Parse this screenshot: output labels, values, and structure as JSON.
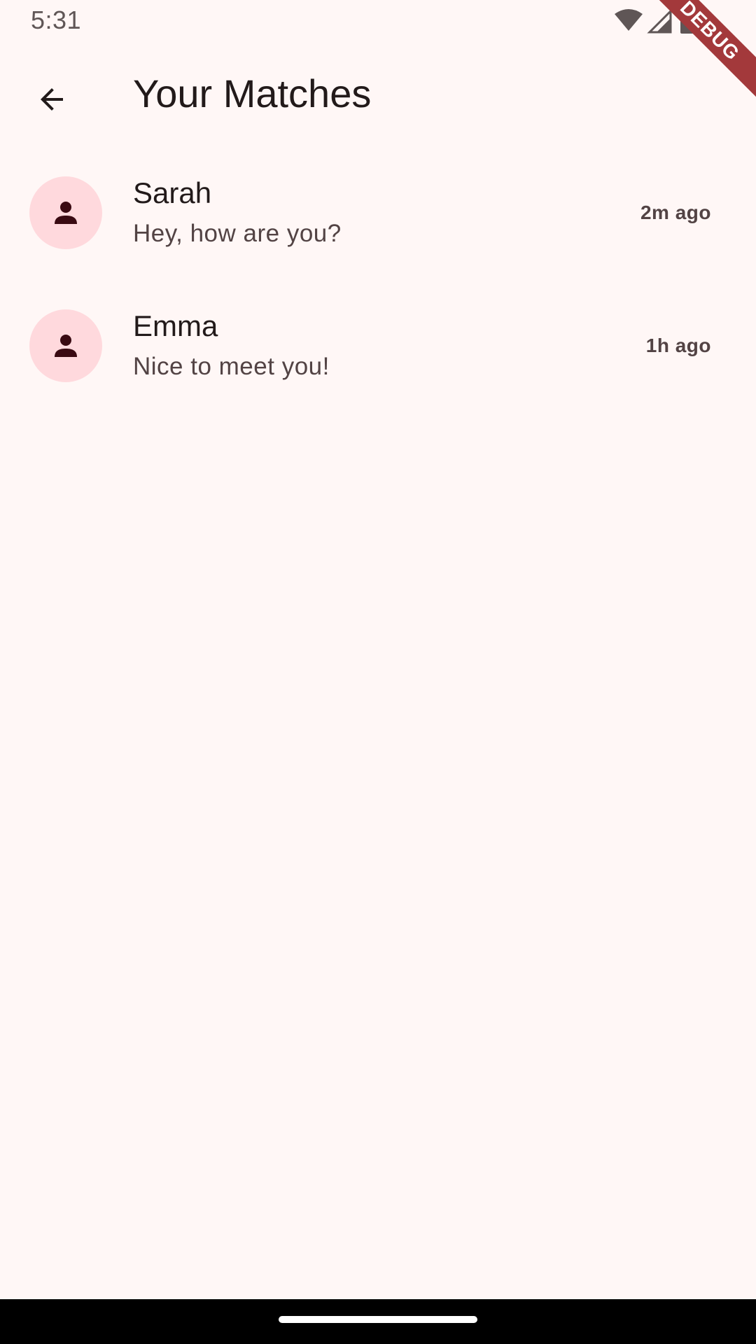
{
  "status_bar": {
    "time": "5:31",
    "icons": [
      "wifi-icon",
      "signal-icon",
      "battery-icon"
    ]
  },
  "debug_banner": {
    "label": "DEBUG"
  },
  "app_bar": {
    "back_icon": "arrow-back-icon",
    "title": "Your Matches"
  },
  "matches": [
    {
      "avatar_icon": "person-icon",
      "name": "Sarah",
      "message": "Hey, how are you?",
      "time": "2m ago"
    },
    {
      "avatar_icon": "person-icon",
      "name": "Emma",
      "message": "Nice to meet you!",
      "time": "1h ago"
    }
  ],
  "colors": {
    "background": "#FFF7F6",
    "avatar_background": "#FFD9DD",
    "avatar_icon": "#3A0A12",
    "debug_banner": "#A3393B",
    "text_primary": "#221A1A",
    "text_secondary": "#524344"
  }
}
